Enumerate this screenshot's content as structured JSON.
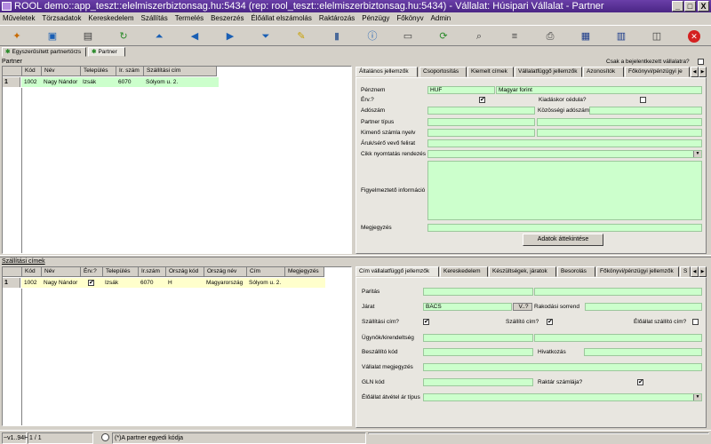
{
  "window": {
    "title": "ROOL demo::app_teszt::elelmiszerbiztonsag.hu:5434 (rep: rool_teszt::elelmiszerbiztonsag.hu:5434) - Vállalat: Húsipari Vállalat - Partner"
  },
  "window_buttons": {
    "minimize": "_",
    "maximize": "□",
    "close": "X"
  },
  "menu": [
    "Műveletek",
    "Törzsadatok",
    "Kereskedelem",
    "Szállítás",
    "Termelés",
    "Beszerzés",
    "Élőállat elszámolás",
    "Raktározás",
    "Pénzügy",
    "Főkönyv",
    "Admin"
  ],
  "toolbar_icons": [
    "wizard-icon",
    "open-icon",
    "save-icon",
    "refresh-icon",
    "first-record-icon",
    "previous-record-icon",
    "next-record-icon",
    "last-record-icon",
    "edit-icon",
    "delete-icon",
    "info-icon",
    "form-icon",
    "reload-icon",
    "search-icon",
    "list-icon",
    "print-icon",
    "calendar-icon",
    "table-icon",
    "window-icon",
    "close-icon"
  ],
  "doc_tabs": [
    {
      "label": "Egyszerűsített partnertörzs"
    },
    {
      "label": "Partner"
    }
  ],
  "partner_section": {
    "label": "Partner",
    "columns": [
      "Kód",
      "Név",
      "Település",
      "Ir. szám",
      "Szállítási cím"
    ],
    "rows": [
      {
        "num": "1",
        "cells": [
          "1002",
          "Nagy Nándor",
          "Izsák",
          "6070",
          "Sólyom u. 2."
        ]
      }
    ]
  },
  "only_logged_company": "Csak a bejelentkezett vállalatra?",
  "top_tabs": [
    "Általános jellemzők",
    "Csoportosítás",
    "Kiemelt címek",
    "Vállalatfüggő jellemzők",
    "Azonosítók",
    "Főkönyvi/pénzügyi je"
  ],
  "general": {
    "currency_label": "Pénznem",
    "currency_code": "HUF",
    "currency_name": "Magyar forint",
    "valid_label": "Érv.?",
    "valid_checked": "✔",
    "delivery_note_label": "Kiadáskor cédula?",
    "tax_number_label": "Adószám",
    "eu_tax_number_label": "Közösségi adószám",
    "partner_type_label": "Partner típus",
    "invoice_language_label": "Kimenő számla nyelv",
    "buyer_label_label": "Áruk/sérő vevő felirat",
    "sort_order_label": "Cikk nyomtatás rendezés",
    "warning_info_label": "Figyelmeztető információ",
    "note_label": "Megjegyzés",
    "overview_button": "Adatok áttekintése"
  },
  "shipping_section": {
    "label": "Szállítási címek",
    "columns": [
      "Kód",
      "Név",
      "Érv.?",
      "Település",
      "Ir.szám",
      "Ország kód",
      "Ország név",
      "Cím",
      "Megjegyzés"
    ],
    "rows": [
      {
        "num": "1",
        "cells": [
          "1002",
          "Nagy Nándor",
          "✔",
          "Izsák",
          "6070",
          "H",
          "Magyarország",
          "Sólyom u. 2.",
          ""
        ]
      }
    ]
  },
  "bottom_tabs": [
    "Cím vállalatfüggő jellemzők",
    "Kereskedelem",
    "Készültségek, járatok",
    "Besorolás",
    "Főkönyvi/pénzügyi jellemzők",
    "S"
  ],
  "address_company": {
    "parity_label": "Paritás",
    "route_label": "Járat",
    "route_value": "BÁCS",
    "route_button": "V..?",
    "unload_order_label": "Rakodási sorrend",
    "shipping_address_label": "Szállítási cím?",
    "shipping_address_checked": "✔",
    "supplier_address_label": "Szállító cím?",
    "supplier_address_checked": "✔",
    "livestock_address_label": "Élőállat szállító cím?",
    "agent_label": "Ügynök/kirendeltség",
    "supplier_code_label": "Beszállító kód",
    "office_label": "Hivatkozás",
    "company_note_label": "Vállalat megjegyzés",
    "gln_label": "GLN kód",
    "warehouse_invoice_label": "Raktár számlája?",
    "warehouse_invoice_checked": "✔",
    "livestock_price_label": "Élőállat átvétel ár típus"
  },
  "status": {
    "version": "~v1..94H",
    "records": "1 / 1",
    "hint": "(*)A partner egyedi kódja"
  }
}
